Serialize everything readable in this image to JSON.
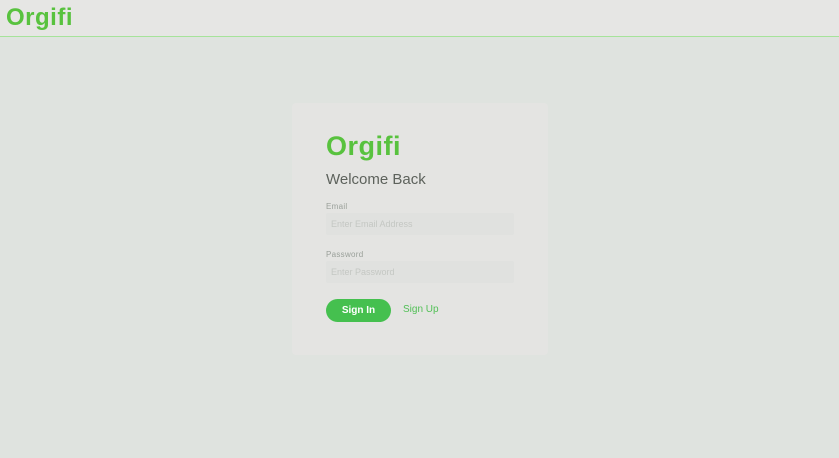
{
  "header": {
    "logo_text": "Orgifi"
  },
  "login": {
    "logo_text": "Orgifi",
    "heading": "Welcome Back",
    "email_label": "Email",
    "email_placeholder": "Enter Email Address",
    "email_value": "",
    "password_label": "Password",
    "password_placeholder": "Enter Password",
    "password_value": "",
    "signin_label": "Sign In",
    "signup_label": "Sign Up"
  },
  "colors": {
    "brand_green": "#58c23e",
    "button_green": "#45c04f",
    "link_green": "#52c057",
    "header_border": "#a6e39a",
    "page_background": "#dfe3df"
  }
}
